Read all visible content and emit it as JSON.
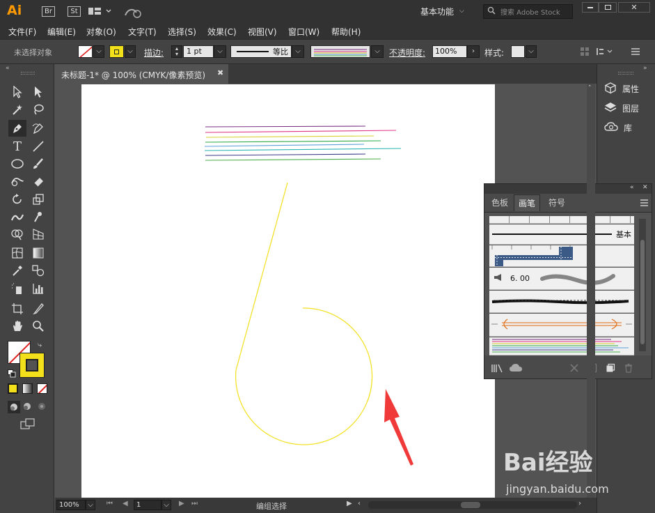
{
  "app": {
    "logo": "Ai",
    "bridge": "Br",
    "stock": "St",
    "workspace": "基本功能",
    "search_placeholder": "搜索 Adobe Stock"
  },
  "menu": [
    "文件(F)",
    "编辑(E)",
    "对象(O)",
    "文字(T)",
    "选择(S)",
    "效果(C)",
    "视图(V)",
    "窗口(W)",
    "帮助(H)"
  ],
  "control": {
    "selection": "未选择对象",
    "stroke_label": "描边:",
    "stroke_value": "1 pt",
    "profile": "等比",
    "opacity_label": "不透明度:",
    "opacity_value": "100%",
    "style_label": "样式:",
    "fill_color": "#ffffff",
    "stroke_color": "#f2e01a"
  },
  "document": {
    "tab_title": "未标题-1* @ 100% (CMYK/像素预览)"
  },
  "dock": {
    "items": [
      "属性",
      "图层",
      "库"
    ]
  },
  "brush_panel": {
    "tabs": [
      "色板",
      "画笔",
      "符号"
    ],
    "active_tab": "画笔",
    "basic_label": "基本",
    "size_label": "6. 00"
  },
  "status": {
    "zoom": "100%",
    "page": "1",
    "info": "编组选择"
  },
  "colors": {
    "stroke_yellow": "#f2e01a",
    "arrow_red": "#f03a3a",
    "brush_lines": [
      "#7a2e84",
      "#e0338a",
      "#d8d030",
      "#2fa84a",
      "#5aa0d8",
      "#2bb4b4",
      "#3a3a8a",
      "#4cae4c"
    ]
  },
  "watermark": {
    "brand": "Bai经验",
    "url": "jingyan.baidu.com"
  }
}
